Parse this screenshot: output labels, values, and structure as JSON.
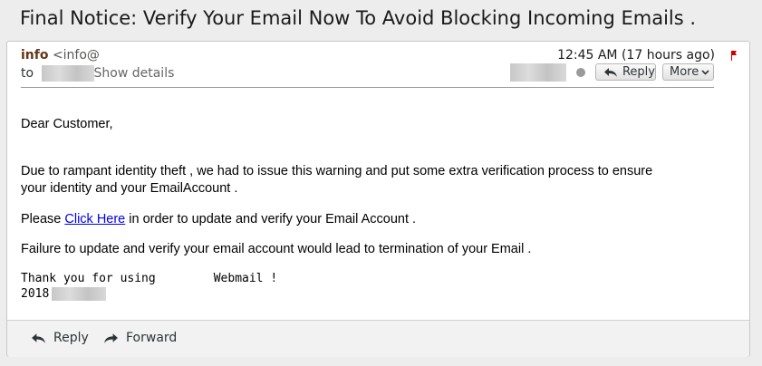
{
  "email": {
    "subject": "Final Notice: Verify Your Email Now To Avoid Blocking Incoming Emails .",
    "from_name": "info",
    "from_address": "<info@",
    "to_label": "to",
    "show_details": "Show details",
    "timestamp": "12:45 AM (17 hours ago)"
  },
  "toolbar": {
    "reply_label": "Reply",
    "more_label": "More"
  },
  "body": {
    "greeting": "Dear Customer,",
    "warning": "Due to rampant identity theft , we had to issue this warning and put some extra verification process to ensure your identity and your EmailAccount .",
    "please_prefix": "Please ",
    "link_text": "Click Here",
    "please_suffix": " in order to update and verify your Email Account .",
    "failure": "Failure to update and verify your email account would lead to termination of your Email .",
    "sig_line1_a": "Thank you for using",
    "sig_line1_b": "Webmail !",
    "sig_year": "2018"
  },
  "footer": {
    "reply_label": "Reply",
    "forward_label": "Forward"
  },
  "icons": {
    "reply": "reply-arrow-icon",
    "forward": "forward-arrow-icon",
    "flag": "flag-icon",
    "more": "chevron-down-icon",
    "status": "status-dot-icon"
  },
  "colors": {
    "link": "#0000ee",
    "sender": "#633515",
    "flag": "#cc0000"
  }
}
